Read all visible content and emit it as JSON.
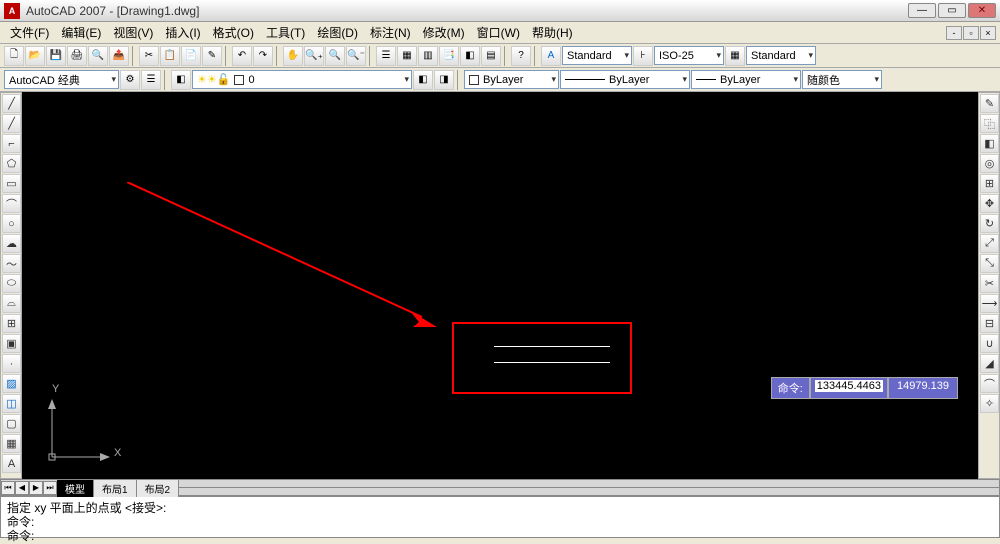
{
  "title": "AutoCAD 2007 - [Drawing1.dwg]",
  "menus": [
    "文件(F)",
    "编辑(E)",
    "视图(V)",
    "插入(I)",
    "格式(O)",
    "工具(T)",
    "绘图(D)",
    "标注(N)",
    "修改(M)",
    "窗口(W)",
    "帮助(H)"
  ],
  "workspace": "AutoCAD 经典",
  "layer": "0",
  "prop_row": {
    "color": "ByLayer",
    "linetype": "ByLayer",
    "lineweight": "ByLayer",
    "plotstyle": "随颜色"
  },
  "style_row": {
    "textstyle": "Standard",
    "dimstyle": "ISO-25",
    "tablestyle": "Standard"
  },
  "tabs": {
    "model": "模型",
    "layout1": "布局1",
    "layout2": "布局2"
  },
  "cmd": {
    "line1": "指定 xy 平面上的点或 <接受>:",
    "prompt": "命令:"
  },
  "dyn": {
    "label": "命令:",
    "x": "133445.4463",
    "y": "14979.139"
  },
  "ucs": {
    "x": "X",
    "y": "Y"
  }
}
